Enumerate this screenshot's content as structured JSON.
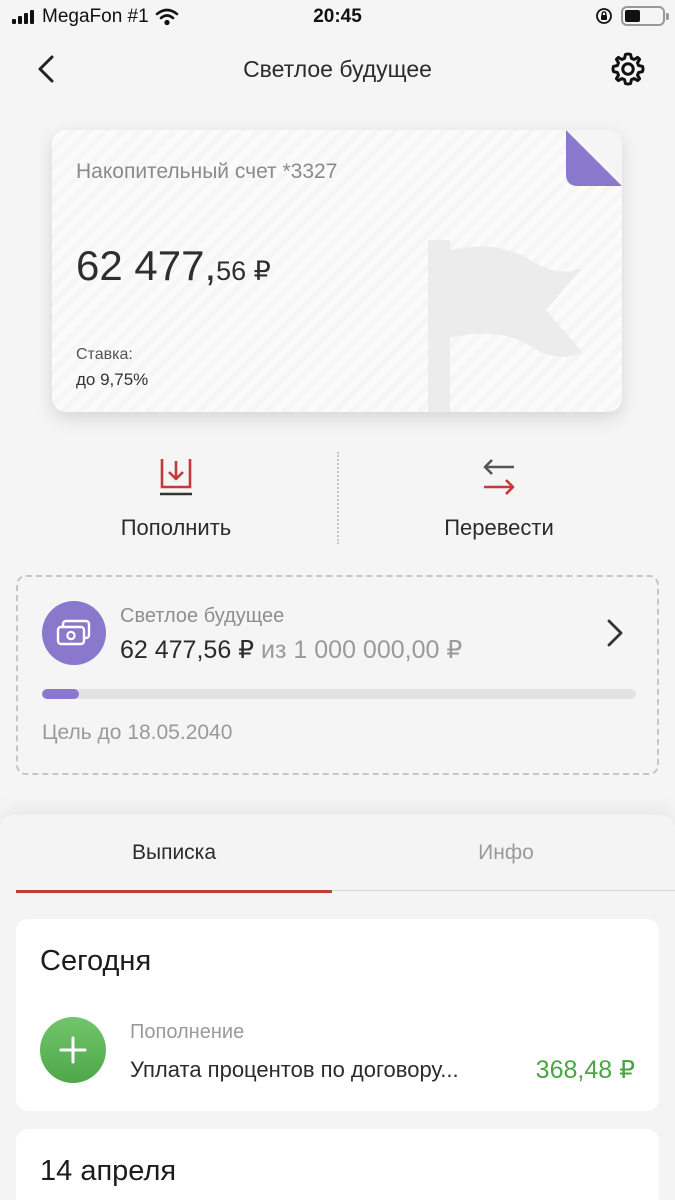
{
  "status_bar": {
    "carrier": "MegaFon #1",
    "time": "20:45"
  },
  "nav": {
    "title": "Светлое будущее"
  },
  "account_card": {
    "label": "Накопительный счет *3327",
    "balance_integer": "62 477,",
    "balance_fraction": "56 ₽",
    "rate_label": "Ставка:",
    "rate_value": "до 9,75%",
    "accent_color": "#8a78cc"
  },
  "actions": {
    "topup_label": "Пополнить",
    "transfer_label": "Перевести"
  },
  "goal": {
    "name": "Светлое будущее",
    "current": "62 477,56 ₽",
    "separator": "из",
    "target": "1 000 000,00 ₽",
    "progress_fraction": 0.0625,
    "deadline": "Цель до 18.05.2040"
  },
  "tabs": {
    "statement": "Выписка",
    "info": "Инфо"
  },
  "statement": {
    "today": {
      "title": "Сегодня",
      "transaction": {
        "type": "Пополнение",
        "description": "Уплата процентов по договору...",
        "amount": "368,48 ₽",
        "icon": "plus-icon"
      }
    },
    "april": {
      "title": "14 апреля"
    }
  },
  "colors": {
    "accent_purple": "#8a78cc",
    "accent_red": "#c33a3a",
    "positive_green": "#4aa544"
  }
}
